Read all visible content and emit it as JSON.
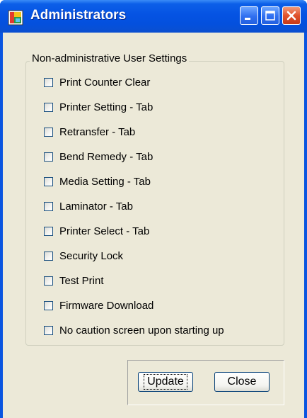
{
  "window": {
    "title": "Administrators",
    "controls": {
      "minimize": "minimize-icon",
      "maximize": "maximize-icon",
      "close": "close-icon"
    }
  },
  "group": {
    "title": "Non-administrative User Settings",
    "items": [
      {
        "label": "Print Counter Clear",
        "checked": false
      },
      {
        "label": "Printer Setting - Tab",
        "checked": false
      },
      {
        "label": "Retransfer - Tab",
        "checked": false
      },
      {
        "label": "Bend Remedy - Tab",
        "checked": false
      },
      {
        "label": "Media Setting - Tab",
        "checked": false
      },
      {
        "label": "Laminator - Tab",
        "checked": false
      },
      {
        "label": "Printer Select - Tab",
        "checked": false
      },
      {
        "label": "Security Lock",
        "checked": false
      },
      {
        "label": "Test Print",
        "checked": false
      },
      {
        "label": "Firmware Download",
        "checked": false
      },
      {
        "label": "No caution screen upon starting up",
        "checked": false
      }
    ]
  },
  "buttons": {
    "update": "Update",
    "close": "Close"
  }
}
